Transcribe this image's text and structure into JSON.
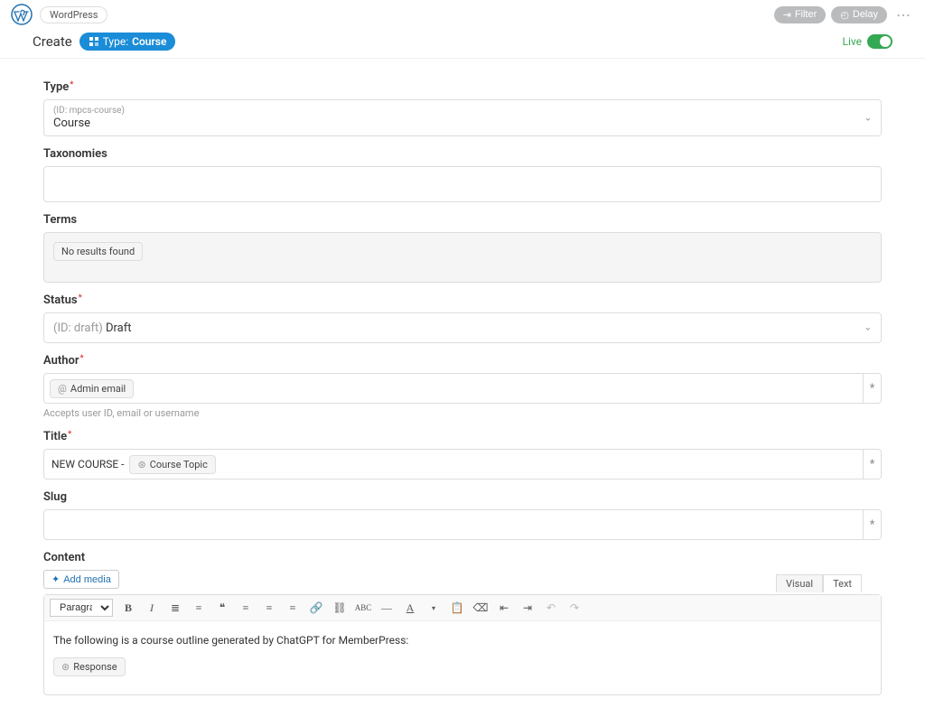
{
  "header": {
    "platform": "WordPress",
    "filter_label": "Filter",
    "delay_label": "Delay"
  },
  "subheader": {
    "create": "Create",
    "type_prefix": "Type:",
    "type_value": "Course",
    "live_label": "Live"
  },
  "fields": {
    "type": {
      "label": "Type",
      "id": "(ID: mpcs-course)",
      "value": "Course"
    },
    "taxonomies": {
      "label": "Taxonomies"
    },
    "terms": {
      "label": "Terms",
      "no_results": "No results found"
    },
    "status": {
      "label": "Status",
      "id_prefix": "(ID: draft)",
      "value": "Draft"
    },
    "author": {
      "label": "Author",
      "chip": "Admin email",
      "help": "Accepts user ID, email or username"
    },
    "title": {
      "label": "Title",
      "prefix": "NEW COURSE -",
      "chip": "Course Topic"
    },
    "slug": {
      "label": "Slug"
    },
    "content": {
      "label": "Content",
      "add_media": "Add media",
      "tab_visual": "Visual",
      "tab_text": "Text",
      "paragraph": "Paragraph",
      "body_line": "The following is a course outline generated by ChatGPT for MemberPress:",
      "response_chip": "Response"
    }
  }
}
